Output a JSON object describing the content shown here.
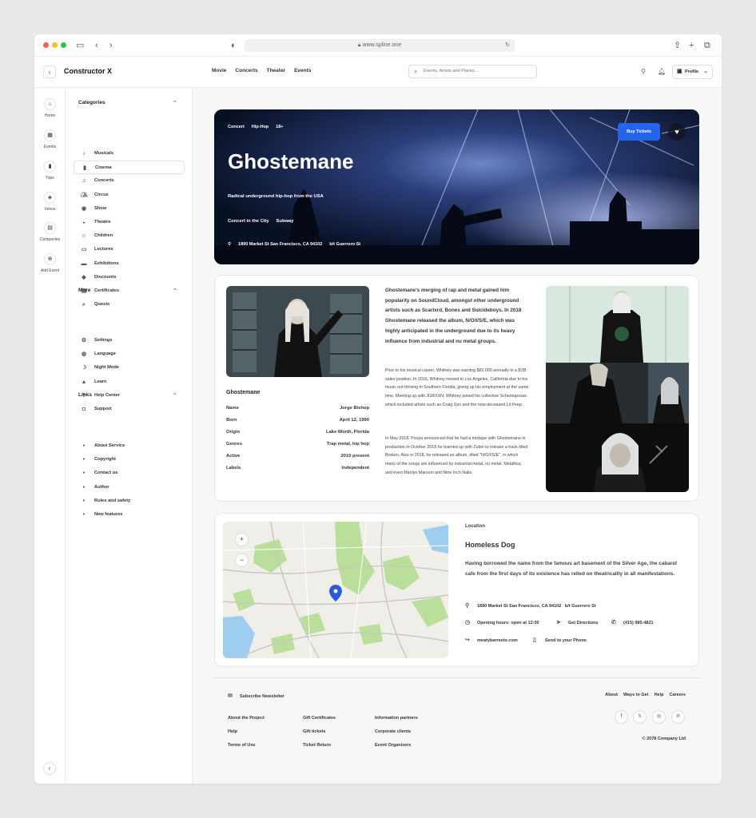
{
  "browser": {
    "url": "www.spline.one"
  },
  "app": {
    "title": "Constructor X"
  },
  "topnav": [
    "Movie",
    "Concerts",
    "Theater",
    "Events"
  ],
  "search": {
    "placeholder": "Events, Artists and Places ..."
  },
  "profile": {
    "label": "Profile"
  },
  "rail": [
    {
      "label": "Home",
      "icon": "home-icon"
    },
    {
      "label": "Events",
      "icon": "calendar-icon"
    },
    {
      "label": "Tops",
      "icon": "chart-icon"
    },
    {
      "label": "Venus",
      "icon": "layers-icon"
    },
    {
      "label": "Companies",
      "icon": "building-icon"
    },
    {
      "label": "Add Event",
      "icon": "plus-circle-icon"
    }
  ],
  "sidebar": {
    "categories_title": "Categories",
    "categories": [
      {
        "label": "Musicals",
        "icon": "music-note-icon"
      },
      {
        "label": "Cinema",
        "icon": "film-icon",
        "active": true
      },
      {
        "label": "Concerts",
        "icon": "microphone-icon"
      },
      {
        "label": "Circus",
        "icon": "tent-icon"
      },
      {
        "label": "Show",
        "icon": "disc-icon"
      },
      {
        "label": "Theatre",
        "icon": "mask-icon"
      },
      {
        "label": "Children",
        "icon": "smile-icon"
      },
      {
        "label": "Lectures",
        "icon": "chat-icon"
      },
      {
        "label": "Exhibitions",
        "icon": "image-icon"
      },
      {
        "label": "Discounts",
        "icon": "tag-icon"
      },
      {
        "label": "Certificates",
        "icon": "certificate-icon"
      },
      {
        "label": "Quests",
        "icon": "search-icon"
      }
    ],
    "more_title": "More",
    "more": [
      {
        "label": "Settings",
        "icon": "gear-icon"
      },
      {
        "label": "Language",
        "icon": "globe-icon"
      },
      {
        "label": "Night Mode",
        "icon": "moon-icon"
      },
      {
        "label": "Learn",
        "icon": "graduation-cap-icon"
      },
      {
        "label": "Help Center",
        "icon": "help-icon"
      },
      {
        "label": "Support",
        "icon": "support-icon"
      }
    ],
    "links_title": "Links",
    "links": [
      "About Service",
      "Copyright",
      "Contact us",
      "Author",
      "Rules and safety",
      "New features"
    ]
  },
  "hero": {
    "tags": [
      "Concert",
      "Hip-Hop",
      "18+"
    ],
    "title": "Ghostemane",
    "subtitle": "Radical underground hip-hop from the USA",
    "venue": [
      "Concert in the City",
      "Subway"
    ],
    "address": "1890 Market St San Francisco, CA 94102",
    "cross": "b/t Guerrero St",
    "buy_label": "Buy Tickets"
  },
  "bio": {
    "name": "Ghostemane",
    "facts": [
      {
        "label": "Name",
        "value": "Jorge Bishop"
      },
      {
        "label": "Born",
        "value": "April 12, 1990"
      },
      {
        "label": "Origin",
        "value": "Lake Worth, Florida"
      },
      {
        "label": "Genres",
        "value": "Trap metal, hip hop"
      },
      {
        "label": "Active",
        "value": "2010 present"
      },
      {
        "label": "Labels",
        "value": "Independent"
      }
    ],
    "lead": "Ghostemane's merging of rap and metal gained him popularity on SoundCloud, amongst other underground artists such as Scarlxrd, Bones and Suicideboys. In 2018 Ghostemane released the album, N/O/I/S/E, which was highly anticipated in the underground due to its heavy influence from industrial and nu metal groups.",
    "p1": "Prior to his musical career, Whitney was earning $65,000 annually in a B2B sales position. In 2015, Whitney moved to Los Angeles, California due to his music not thriving in Southern Florida, giving up his employment at the same time. Meeting up with JGRXXN, Whitney joined his collective Schemaposse which included artists such as Craig Xen and the now-deceased Lil Peep.",
    "p2": "In May 2018, Pouya announced that he had a mixtape with Ghostemane in production.In October 2018 he teamed up with Zubin to release a track titled Broken. Also in 2018, he released an album, titled \"N/O/I/S/E\", in which many of the songs are influenced by industrial metal, nu metal, Metallica, and even Marilyn Manson and Nine Inch Nails."
  },
  "location": {
    "label": "Location",
    "name": "Homeless Dog",
    "description": "Having borrowed the name from the famous art basement of the Silver Age, the cabaret cafe from the first days of its existence has relied on theatricality in all manifestations.",
    "address": "1890 Market St San Francisco, CA 94102",
    "cross": "b/t Guerrero St",
    "hours": "Opening hours: open at 12:00",
    "directions": "Get Directions",
    "phone": "(415) 985-4821",
    "website": "meatybarresto.com",
    "send": "Send to your Phone"
  },
  "footer": {
    "newsletter": "Subscribe Newsletter",
    "top_links": [
      "About",
      "Ways to Get",
      "Help",
      "Careers"
    ],
    "col1": [
      "About the Project",
      "Help",
      "Terms of Use"
    ],
    "col2": [
      "Gift Certificates",
      "Gift tickets",
      "Ticket Return"
    ],
    "col3": [
      "Information partners",
      "Corporate clients",
      "Event Organizers"
    ],
    "social": [
      "facebook-icon",
      "x-icon",
      "instagram-icon",
      "pinterest-icon"
    ],
    "copyright": "© 2078  Company Ltd"
  },
  "colors": {
    "accent": "#2664eb",
    "hero_bg": "#0b1430"
  }
}
